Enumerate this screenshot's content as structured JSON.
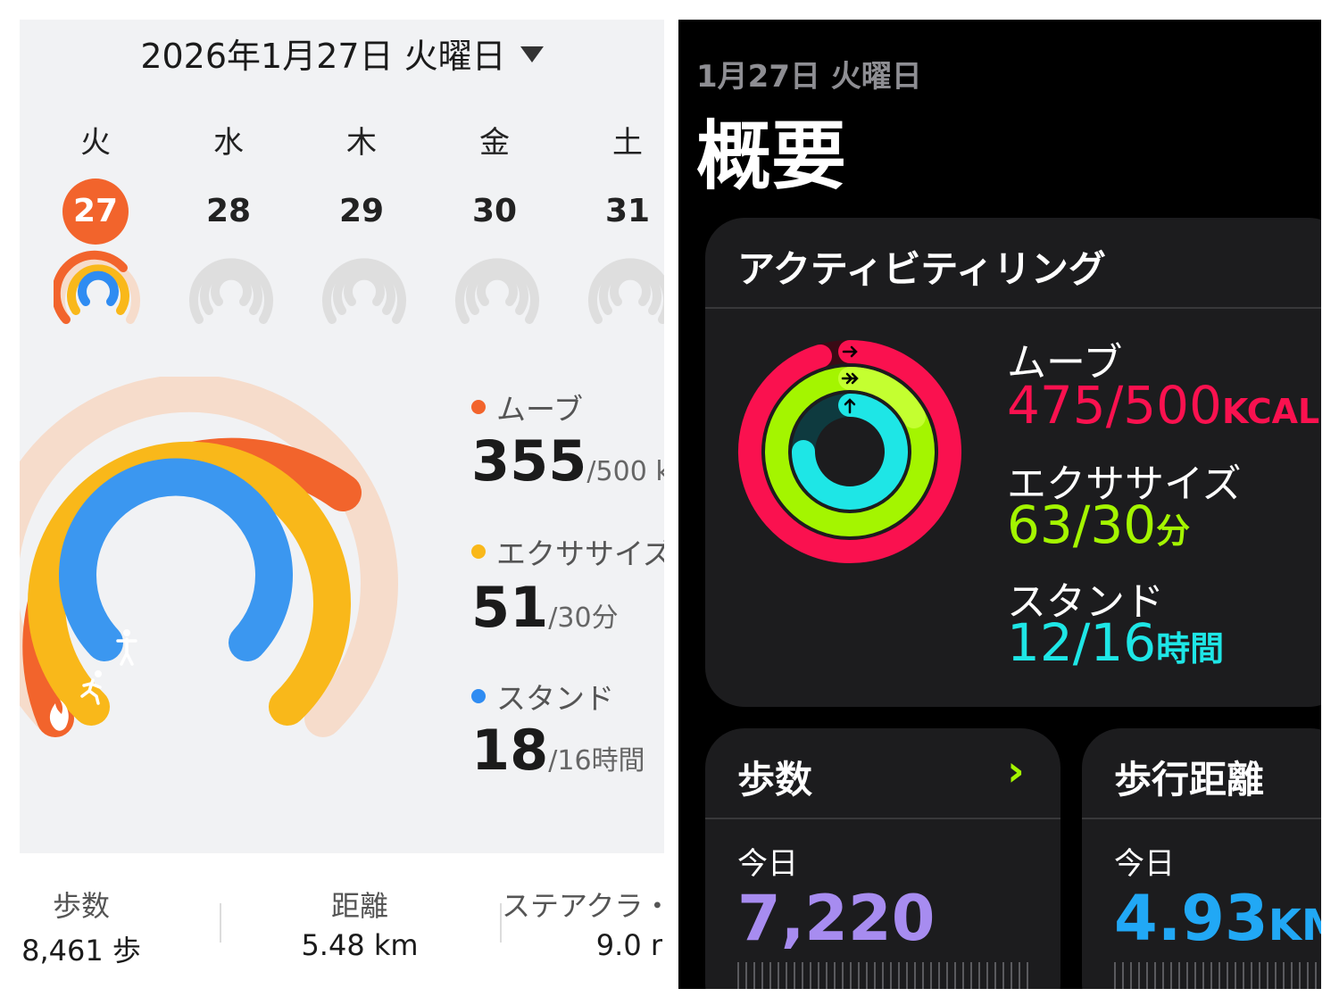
{
  "left": {
    "date_header": "2026年1月27日 火曜日",
    "week": [
      {
        "weekday": "火",
        "day": "27",
        "selected": true
      },
      {
        "weekday": "水",
        "day": "28",
        "selected": false
      },
      {
        "weekday": "木",
        "day": "29",
        "selected": false
      },
      {
        "weekday": "金",
        "day": "30",
        "selected": false
      },
      {
        "weekday": "土",
        "day": "31",
        "selected": false
      }
    ],
    "metrics": {
      "move": {
        "label": "ムーブ",
        "value": "355",
        "goal": "/500 k",
        "color": "#f2642c",
        "progress": 0.71
      },
      "exercise": {
        "label": "エクササイズ",
        "value": "51",
        "goal": "/30分",
        "color": "#f9b81a",
        "progress": 1.0
      },
      "stand": {
        "label": "スタンド",
        "value": "18",
        "goal": "/16時間",
        "color": "#2f8cf2",
        "progress": 1.0
      }
    },
    "stats": [
      {
        "label": "歩数",
        "value": "8,461 歩"
      },
      {
        "label": "距離",
        "value": "5.48 km"
      },
      {
        "label": "ステアクラ・",
        "value": "9.0 r"
      }
    ],
    "icons": {
      "move": "flame-icon",
      "exercise": "running-person-icon",
      "stand": "standing-person-icon"
    }
  },
  "right": {
    "date": "1月27日 火曜日",
    "title": "概要",
    "activity_card": {
      "title": "アクティビティリング",
      "move": {
        "label": "ムーブ",
        "value": "475/500",
        "unit": "KCAL",
        "color": "#fa114f",
        "progress": 0.95
      },
      "exercise": {
        "label": "エクササイズ",
        "value": "63/30",
        "unit": "分",
        "color": "#a4f500",
        "progress": 1.0
      },
      "stand": {
        "label": "スタンド",
        "value": "12/16",
        "unit": "時間",
        "color": "#1ee6e6",
        "progress": 0.75
      }
    },
    "steps_card": {
      "title": "歩数",
      "sub": "今日",
      "value": "7,220",
      "color": "#a78cf0"
    },
    "distance_card": {
      "title": "歩行距離",
      "sub": "今日",
      "value": "4.93",
      "unit": "KM",
      "color": "#21a8f5"
    }
  }
}
